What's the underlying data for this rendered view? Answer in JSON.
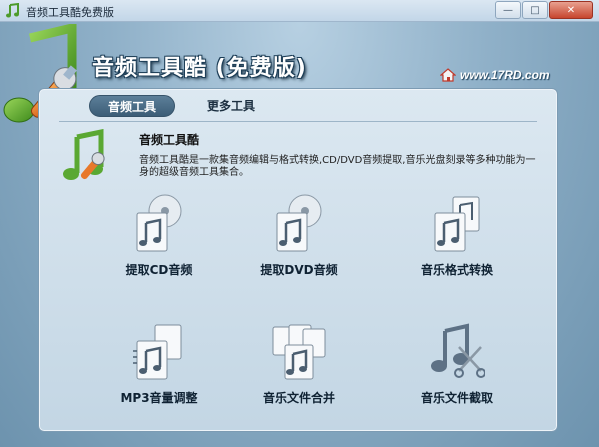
{
  "window": {
    "title": "音频工具酷免费版",
    "minimize_glyph": "—",
    "maximize_glyph": "□",
    "close_glyph": "✕"
  },
  "header": {
    "app_title": "音频工具酷 (免费版)",
    "site": "www.17RD.com"
  },
  "tabs": [
    {
      "label": "音频工具",
      "active": true
    },
    {
      "label": "更多工具",
      "active": false
    }
  ],
  "info": {
    "title": "音频工具酷",
    "description": "音频工具酷是一款集音频编辑与格式转换,CD/DVD音频提取,音乐光盘刻录等多种功能为一身的超级音频工具集合。"
  },
  "tools": [
    {
      "label": "提取CD音频",
      "icon": "cd-music-icon"
    },
    {
      "label": "提取DVD音频",
      "icon": "dvd-music-icon"
    },
    {
      "label": "音乐格式转换",
      "icon": "format-convert-icon"
    },
    {
      "label": "MP3音量调整",
      "icon": "volume-adjust-icon"
    },
    {
      "label": "音乐文件合并",
      "icon": "merge-files-icon"
    },
    {
      "label": "音乐文件截取",
      "icon": "cut-music-icon"
    }
  ],
  "colors": {
    "accent": "#4f7591",
    "note_green": "#5aa832",
    "wrench_orange": "#e8782b"
  }
}
